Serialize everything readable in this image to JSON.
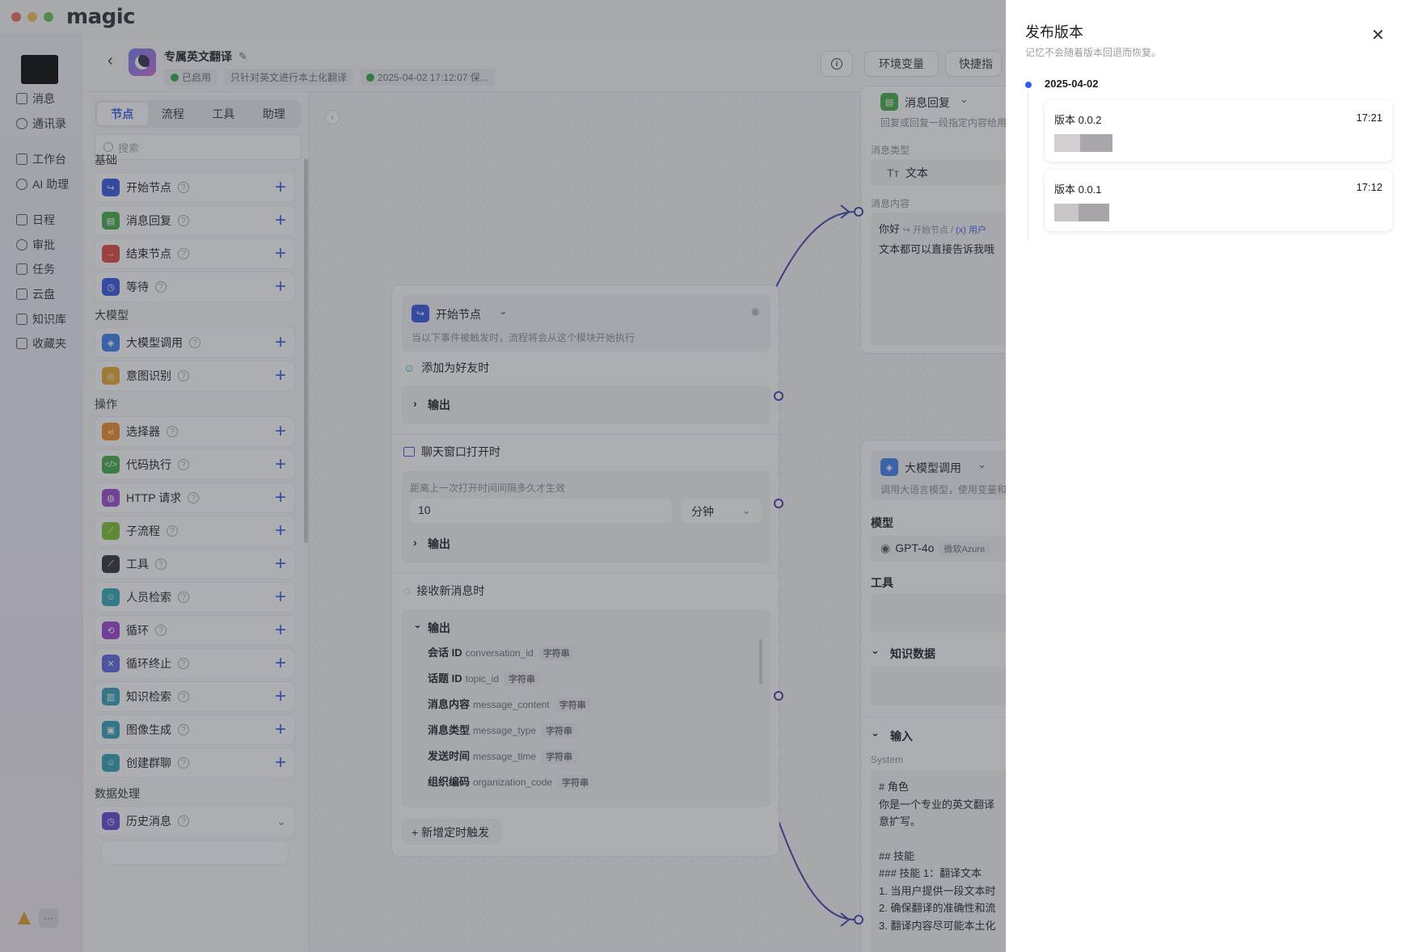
{
  "app": {
    "logo": "magic"
  },
  "nav": {
    "items": [
      {
        "label": "消息",
        "icon": "chat-icon"
      },
      {
        "label": "通讯录",
        "icon": "contacts-icon"
      },
      {
        "label": "工作台",
        "icon": "workbench-icon"
      },
      {
        "label": "AI 助理",
        "icon": "ai-assistant-icon"
      },
      {
        "label": "日程",
        "icon": "calendar-icon"
      },
      {
        "label": "审批",
        "icon": "approval-icon"
      },
      {
        "label": "任务",
        "icon": "task-icon"
      },
      {
        "label": "云盘",
        "icon": "folder-icon"
      },
      {
        "label": "知识库",
        "icon": "knowledge-icon"
      },
      {
        "label": "收藏夹",
        "icon": "favorites-icon"
      }
    ],
    "more": "···"
  },
  "header": {
    "title": "专属英文翻译",
    "status": "已启用",
    "description": "只针对英文进行本土化翻译",
    "saved": "2025-04-02 17:12:07 保...",
    "buttons": [
      "环境变量",
      "快捷指"
    ]
  },
  "panel": {
    "tabs": [
      "节点",
      "流程",
      "工具",
      "助理"
    ],
    "search_placeholder": "搜索",
    "sections": [
      {
        "label": "基础",
        "items": [
          {
            "label": "开始节点",
            "color": "#3554e6"
          },
          {
            "label": "消息回复",
            "color": "#3eab45"
          },
          {
            "label": "结束节点",
            "color": "#e2453a"
          },
          {
            "label": "等待",
            "color": "#3554e6"
          }
        ]
      },
      {
        "label": "大模型",
        "items": [
          {
            "label": "大模型调用",
            "color": "#3a7df0"
          },
          {
            "label": "意图识别",
            "color": "#e8a82f"
          }
        ]
      },
      {
        "label": "操作",
        "items": [
          {
            "label": "选择器",
            "color": "#ef8a25"
          },
          {
            "label": "代码执行",
            "color": "#3eab45"
          },
          {
            "label": "HTTP 请求",
            "color": "#9a44d4"
          },
          {
            "label": "子流程",
            "color": "#7bbf2e"
          },
          {
            "label": "工具",
            "color": "#2b2d35"
          },
          {
            "label": "人员检索",
            "color": "#2fa8b8"
          },
          {
            "label": "循环",
            "color": "#9a3fd1"
          },
          {
            "label": "循环终止",
            "color": "#5564e0"
          },
          {
            "label": "知识检索",
            "color": "#2f9fb8"
          },
          {
            "label": "图像生成",
            "color": "#2f9fb8"
          },
          {
            "label": "创建群聊",
            "color": "#2f9fb8"
          }
        ]
      },
      {
        "label": "数据处理",
        "items": [
          {
            "label": "历史消息",
            "color": "#5a45d6"
          }
        ]
      }
    ]
  },
  "start_node": {
    "title": "开始节点",
    "desc": "当以下事件被触发时，流程将会从这个模块开始执行",
    "trigger1": "添加为好友时",
    "output": "输出",
    "trigger2": "聊天窗口打开时",
    "interval_label": "距离上一次打开时间间隔多久才生效",
    "interval_value": "10",
    "interval_unit": "分钟",
    "trigger3": "接收新消息时",
    "fields": [
      {
        "name": "会话 ID",
        "key": "conversation_id",
        "type": "字符串"
      },
      {
        "name": "话题 ID",
        "key": "topic_id",
        "type": "字符串"
      },
      {
        "name": "消息内容",
        "key": "message_content",
        "type": "字符串"
      },
      {
        "name": "消息类型",
        "key": "message_type",
        "type": "字符串"
      },
      {
        "name": "发送时间",
        "key": "message_time",
        "type": "字符串"
      },
      {
        "name": "组织编码",
        "key": "organization_code",
        "type": "字符串"
      }
    ],
    "add_timer": "+ 新增定时触发"
  },
  "reply_node": {
    "title": "消息回复",
    "desc": "回复或回复一段指定内容给用",
    "type_label": "消息类型",
    "type_value": "文本",
    "content_label": "消息内容",
    "content_line1": "你好",
    "content_ref1": "开始节点",
    "content_ref2": "用户",
    "content_line2": "文本都可以直接告诉我哦"
  },
  "llm_node": {
    "title": "大模型调用",
    "desc": "调用大语言模型，使用变量和",
    "model_label": "模型",
    "model_value": "GPT-4o",
    "model_tag": "微软Azure",
    "tools_label": "工具",
    "knowledge_label": "知识数据",
    "input_label": "输入",
    "system_label": "System",
    "system_lines": [
      "# 角色",
      "你是一个专业的英文翻译",
      "意扩写。",
      "",
      "## 技能",
      "### 技能 1：翻译文本",
      "1. 当用户提供一段文本时",
      "2. 确保翻译的准确性和流",
      "3. 翻译内容尽可能本土化"
    ]
  },
  "drawer": {
    "title": "发布版本",
    "subtitle": "记忆不会随着版本回退而恢复。",
    "date": "2025-04-02",
    "versions": [
      {
        "name": "版本 0.0.2",
        "time": "17:21"
      },
      {
        "name": "版本 0.0.1",
        "time": "17:12"
      }
    ]
  }
}
